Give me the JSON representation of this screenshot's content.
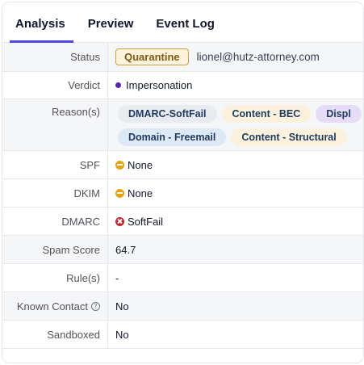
{
  "tabs": [
    {
      "label": "Analysis",
      "active": true
    },
    {
      "label": "Preview",
      "active": false
    },
    {
      "label": "Event Log",
      "active": false
    }
  ],
  "fields": {
    "status": {
      "label": "Status",
      "badge": "Quarantine",
      "email": "lionel@hutz-attorney.com"
    },
    "verdict": {
      "label": "Verdict",
      "value": "Impersonation",
      "dot_color": "#5b21b6"
    },
    "reasons": {
      "label": "Reason(s)",
      "line1": [
        "DMARC-SoftFail",
        "Content - BEC",
        "Displ"
      ],
      "line2": [
        "Domain - Freemail",
        "Content - Structural"
      ]
    },
    "spf": {
      "label": "SPF",
      "value": "None",
      "icon": "minus-circle-icon"
    },
    "dkim": {
      "label": "DKIM",
      "value": "None",
      "icon": "minus-circle-icon"
    },
    "dmarc": {
      "label": "DMARC",
      "value": "SoftFail",
      "icon": "x-circle-icon"
    },
    "spam_score": {
      "label": "Spam Score",
      "value": "64.7"
    },
    "rules": {
      "label": "Rule(s)",
      "value": "-"
    },
    "known_contact": {
      "label": "Known Contact",
      "value": "No",
      "icon": "help-circle-icon"
    },
    "sandboxed": {
      "label": "Sandboxed",
      "value": "No"
    }
  },
  "colors": {
    "accent": "#4f46e5",
    "quarantine_border": "#c7a14a",
    "none_status": "#e6a314",
    "fail_status": "#c0262d"
  }
}
